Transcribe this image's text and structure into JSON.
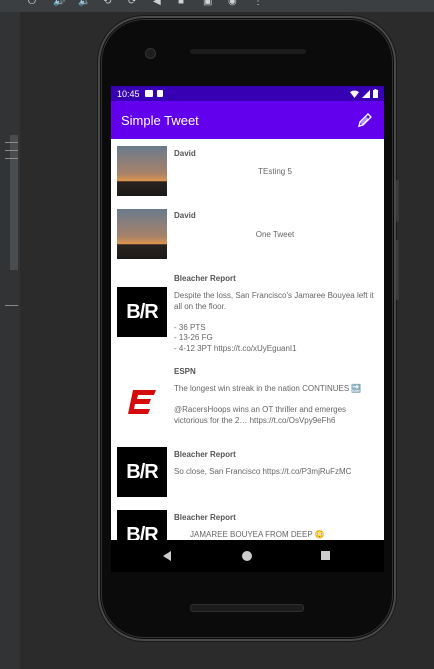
{
  "status_bar": {
    "time": "10:45"
  },
  "app_bar": {
    "title": "Simple Tweet",
    "compose_icon": "pencil-icon"
  },
  "colors": {
    "primary": "#6200ee",
    "primary_dark": "#3700b3",
    "espn_red": "#d50a0a"
  },
  "tweets": [
    {
      "name": "David",
      "body": "TEsting 5",
      "avatar": "photo"
    },
    {
      "name": "David",
      "body": "One Tweet",
      "avatar": "photo"
    },
    {
      "name": "Bleacher Report",
      "body": "Despite the loss, San Francisco's Jamaree Bouyea left it all on the floor.\n\n- 36 PTS\n- 13-26 FG\n- 4-12 3PT https://t.co/xUyEguanI1",
      "avatar": "B/R"
    },
    {
      "name": "ESPN",
      "body": "The longest win streak in the nation CONTINUES 🔜\n\n@RacersHoops wins an OT thriller and emerges victorious for the 2… https://t.co/OsVpy9eFh6",
      "avatar": "espn"
    },
    {
      "name": "Bleacher Report",
      "body": "So close, San Francisco https://t.co/P3mjRuFzMC",
      "avatar": "B/R"
    },
    {
      "name": "Bleacher Report",
      "body": "JAMAREE BOUYEA FROM DEEP 😳",
      "avatar": "B/R"
    }
  ]
}
